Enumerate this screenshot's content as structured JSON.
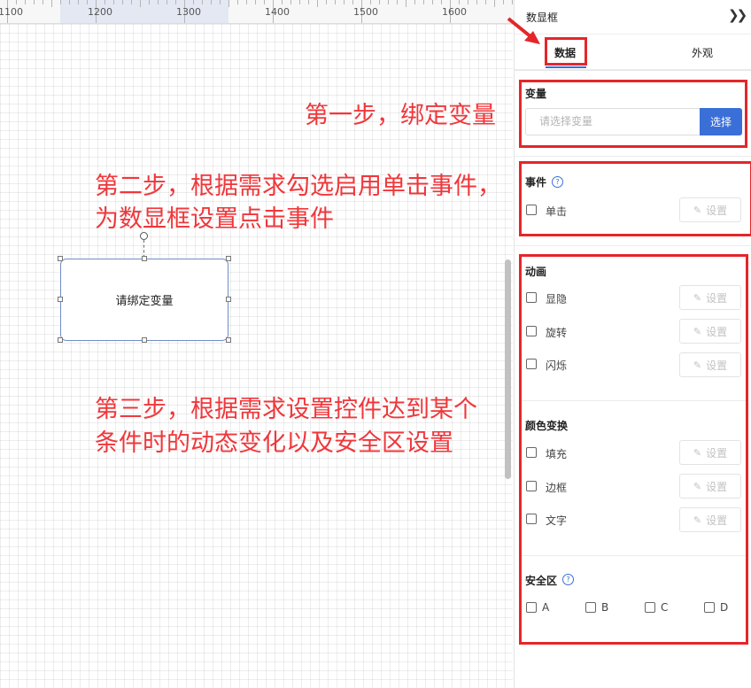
{
  "ruler": {
    "labels": [
      "1100",
      "1200",
      "1300",
      "1400",
      "1500",
      "1600"
    ]
  },
  "widget": {
    "text": "请绑定变量"
  },
  "annotations": {
    "step1": "第一步，绑定变量",
    "step2_line1": "第二步，根据需求勾选启用单击事件，",
    "step2_line2": "为数显框设置点击事件",
    "step3_line1": "第三步，根据需求设置控件达到某个",
    "step3_line2": "条件时的动态变化以及安全区设置"
  },
  "panel": {
    "title": "数显框",
    "collapse_icon": "double-chevron-right-icon",
    "tabs": {
      "data": "数据",
      "appearance": "外观"
    },
    "variable": {
      "title": "变量",
      "placeholder": "请选择变量",
      "button": "选择"
    },
    "event": {
      "title": "事件",
      "help": "?",
      "items": [
        {
          "label": "单击",
          "button": "设置"
        }
      ]
    },
    "animation": {
      "title": "动画",
      "items": [
        {
          "label": "显隐",
          "button": "设置"
        },
        {
          "label": "旋转",
          "button": "设置"
        },
        {
          "label": "闪烁",
          "button": "设置"
        }
      ]
    },
    "color": {
      "title": "颜色变换",
      "items": [
        {
          "label": "填充",
          "button": "设置"
        },
        {
          "label": "边框",
          "button": "设置"
        },
        {
          "label": "文字",
          "button": "设置"
        }
      ]
    },
    "safe": {
      "title": "安全区",
      "help": "?",
      "options": [
        "A",
        "B",
        "C",
        "D"
      ]
    }
  },
  "colors": {
    "accent": "#3a6fd8",
    "annotation": "#f0373b",
    "highlight_box": "#e4262a"
  }
}
